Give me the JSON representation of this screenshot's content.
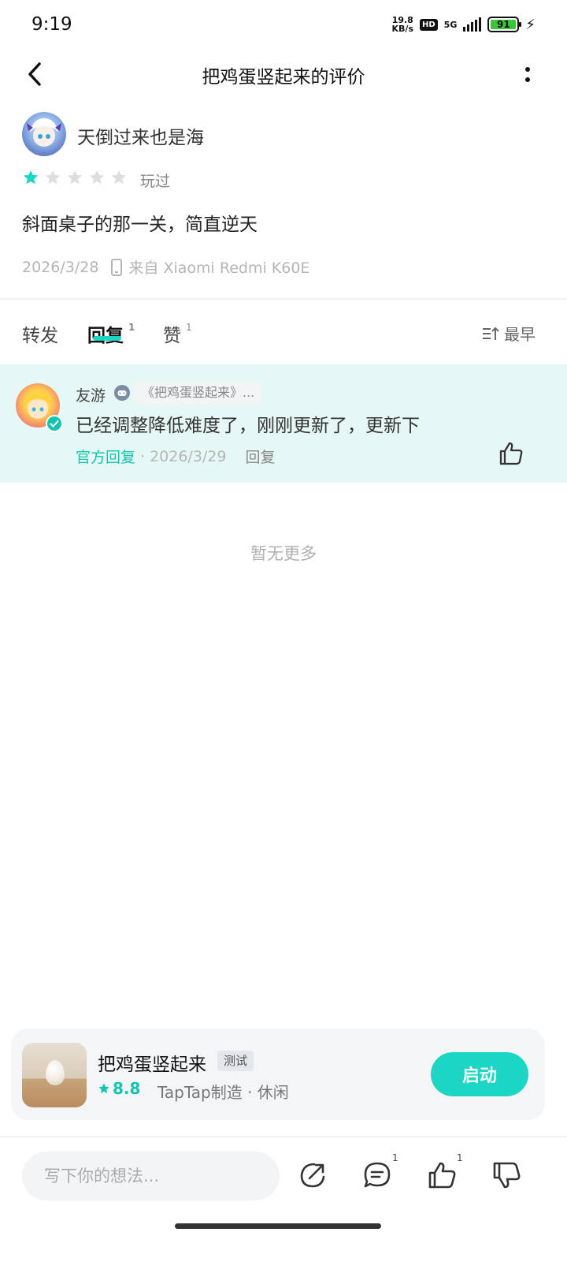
{
  "status_bar": {
    "time": "9:19",
    "net_speed_value": "19.8",
    "net_speed_unit": "KB/s",
    "hd": "HD",
    "network": "5G",
    "battery": "91",
    "charging_icon": "bolt-icon"
  },
  "header": {
    "title": "把鸡蛋竖起来的评价",
    "back_icon": "chevron-left-icon",
    "more_icon": "more-vertical-icon"
  },
  "review": {
    "author": "天倒过来也是海",
    "rating": 1,
    "rating_max": 5,
    "played_tag": "玩过",
    "text": "斜面桌子的那一关，简直逆天",
    "date": "2026/3/28",
    "device": "来自 Xiaomi Redmi K60E"
  },
  "tabs": {
    "repost": "转发",
    "reply": "回复",
    "reply_count": "1",
    "like": "赞",
    "like_count": "1",
    "sort": "最早"
  },
  "reply": {
    "name": "友游",
    "game_chip": "《把鸡蛋竖起来》...",
    "text": "已经调整降低难度了，刚刚更新了，更新下",
    "official": "官方回复",
    "separator": "·",
    "date": "2026/3/29",
    "action": "回复"
  },
  "no_more": "暂无更多",
  "game": {
    "name": "把鸡蛋竖起来",
    "badge": "测试",
    "rating": "8.8",
    "subtitle": "TapTap制造 · 休闲",
    "launch": "启动"
  },
  "bottom_bar": {
    "placeholder": "写下你的想法...",
    "comment_count": "1",
    "like_count": "1"
  },
  "colors": {
    "accent": "#1ad6c3",
    "reply_bg": "#e6f8f6",
    "official": "#13c4ae"
  }
}
